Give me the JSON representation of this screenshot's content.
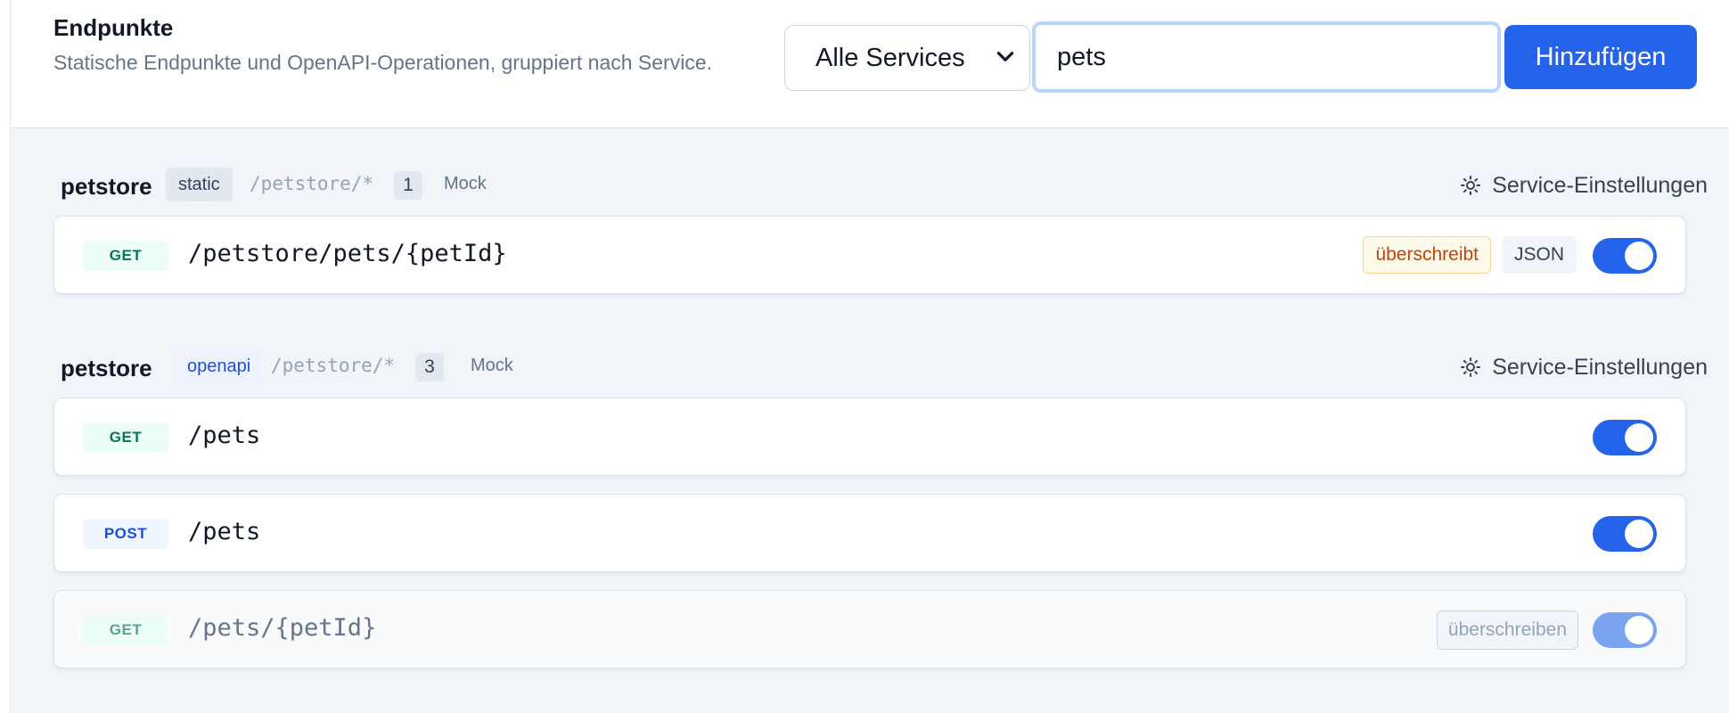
{
  "header": {
    "title": "Endpunkte",
    "subtitle": "Statische Endpunkte und OpenAPI-Operationen, gruppiert nach Service.",
    "service_filter": {
      "selected": "Alle Services"
    },
    "search": {
      "value": "pets"
    },
    "add_label": "Hinzufügen"
  },
  "groups": [
    {
      "name": "petstore",
      "type": "static",
      "prefix": "/petstore/*",
      "count": "1",
      "mode": "Mock",
      "settings_label": "Service-Einstellungen",
      "settings_icon": "gear-icon",
      "endpoints": [
        {
          "method": "GET",
          "path": "/petstore/pets/{petId}",
          "override_badge": "überschreibt",
          "format_badge": "JSON",
          "enabled": true
        }
      ]
    },
    {
      "name": "petstore",
      "type": "openapi",
      "prefix": "/petstore/*",
      "count": "3",
      "mode": "Mock",
      "settings_label": "Service-Einstellungen",
      "settings_icon": "gear-icon",
      "endpoints": [
        {
          "method": "GET",
          "path": "/pets",
          "enabled": true
        },
        {
          "method": "POST",
          "path": "/pets",
          "enabled": true
        },
        {
          "method": "GET",
          "path": "/pets/{petId}",
          "action": "überschreiben",
          "enabled": true,
          "muted": true
        }
      ]
    }
  ],
  "colors": {
    "accent": "#2563eb",
    "background": "#f1f5f9",
    "get": "#047857",
    "post": "#1d4ed8",
    "override": "#c2410c"
  }
}
